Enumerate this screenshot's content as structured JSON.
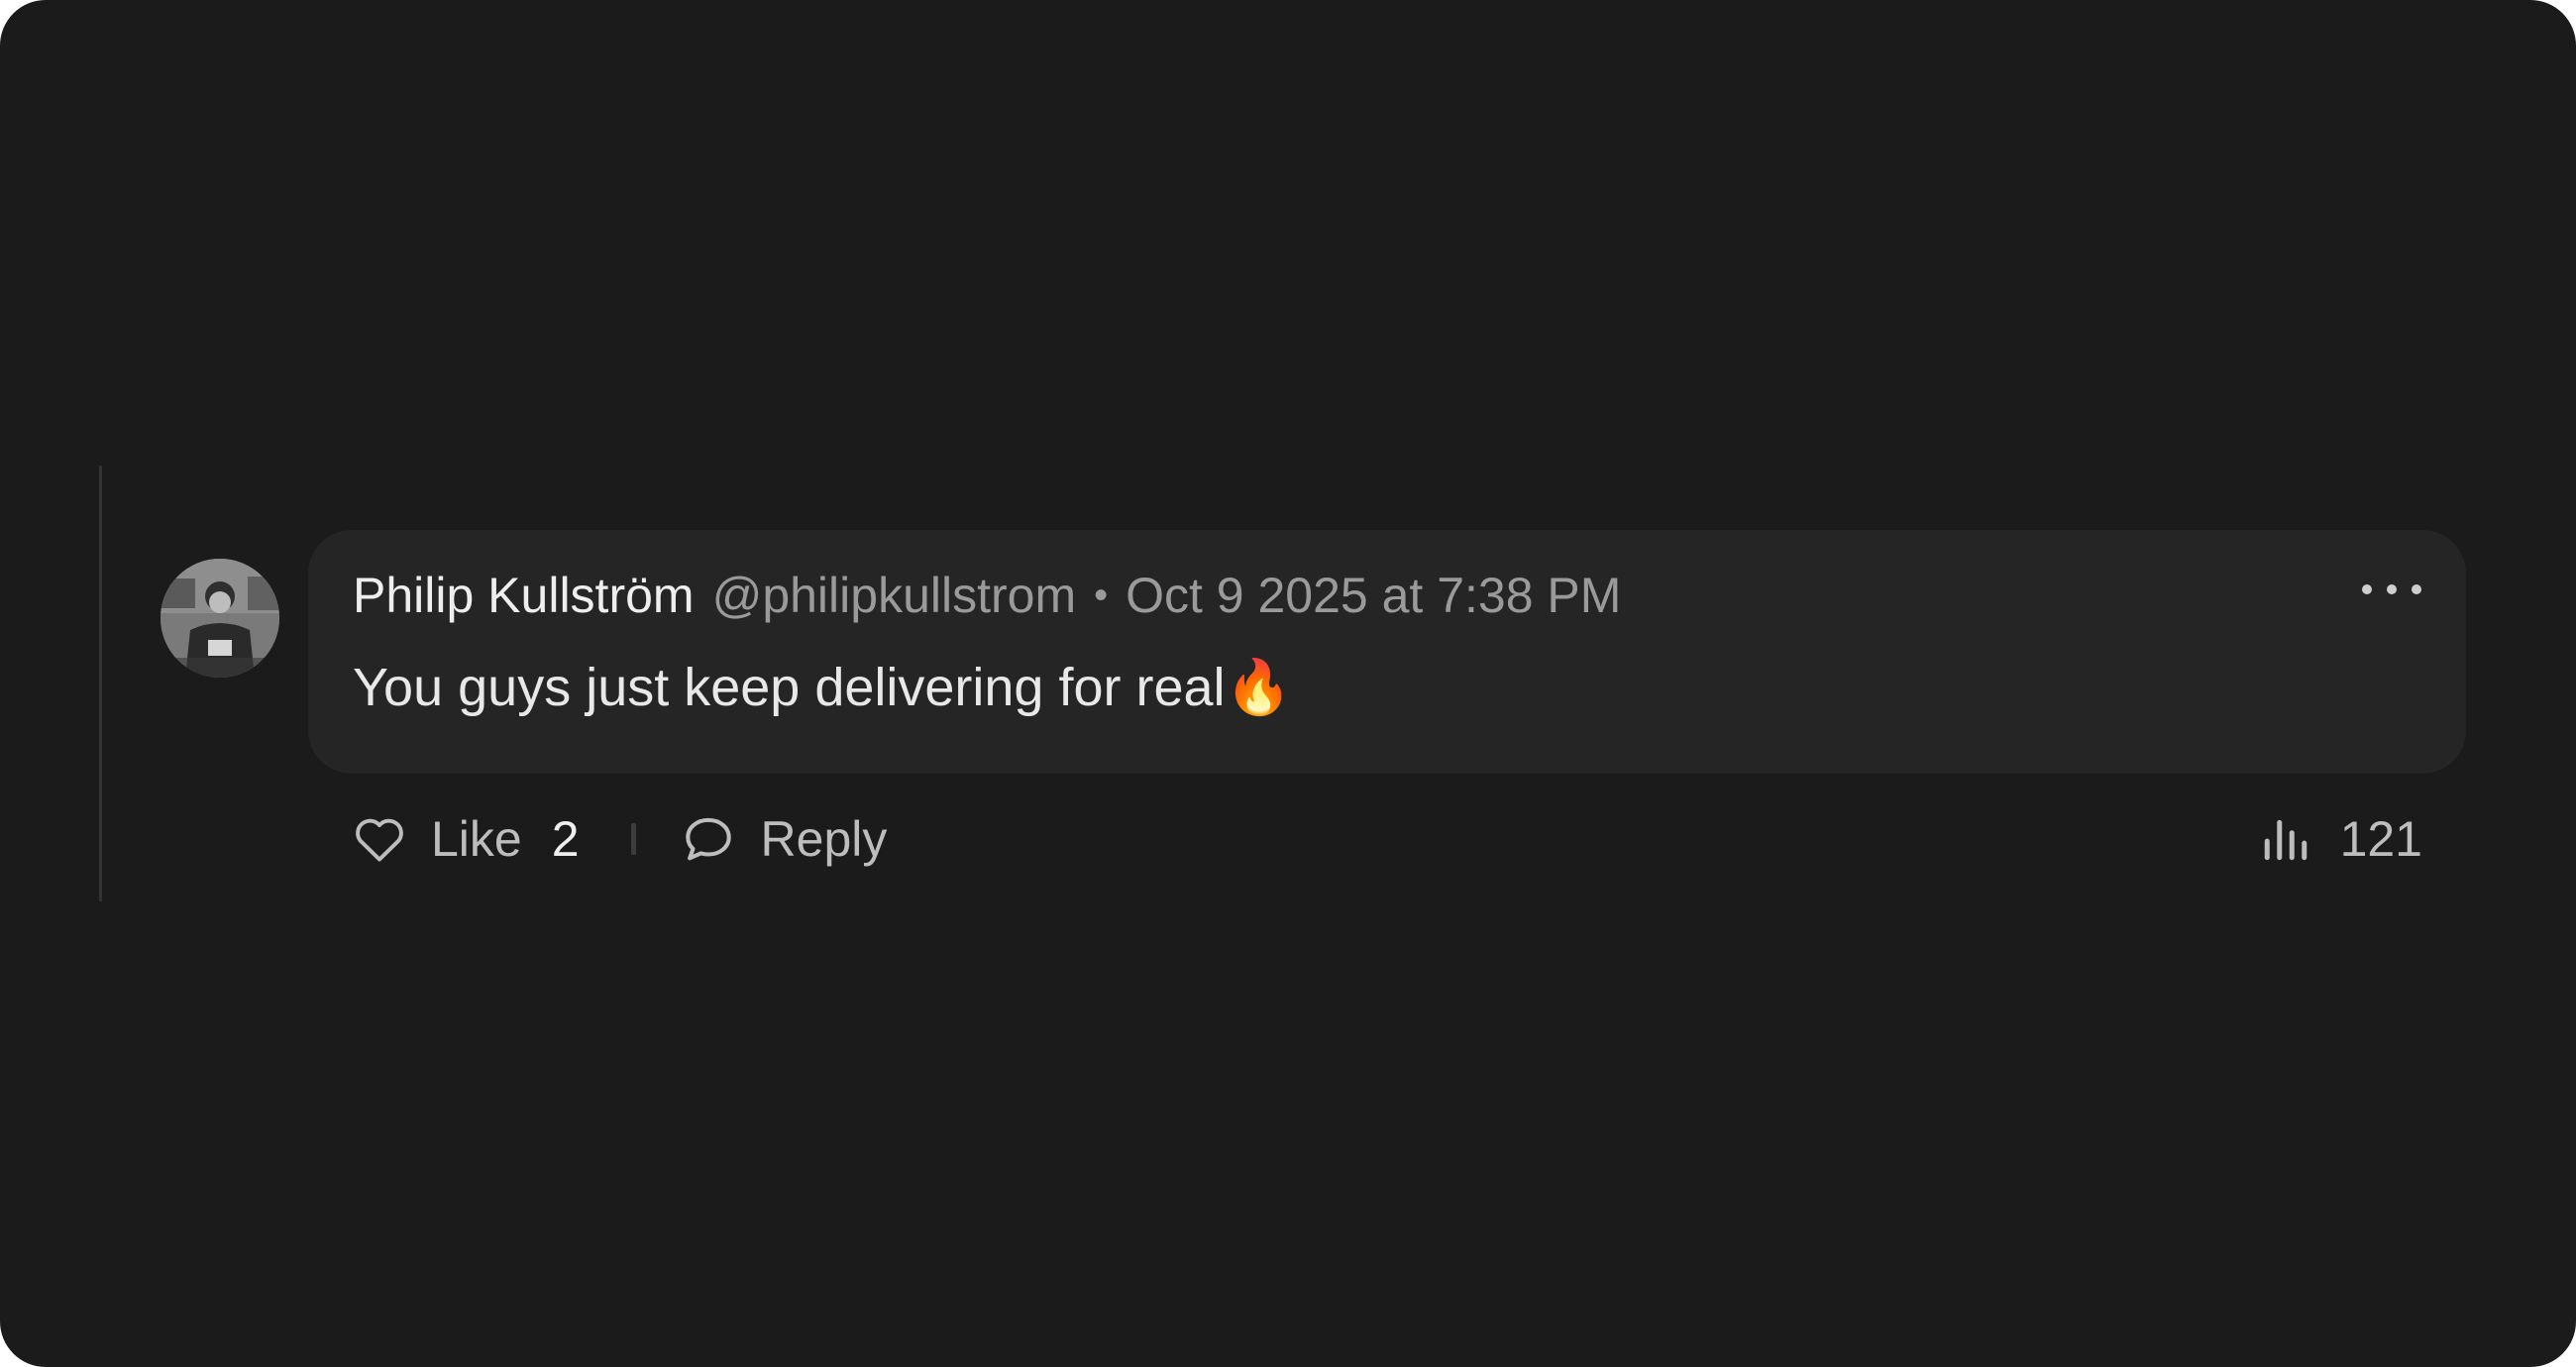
{
  "comment": {
    "author_name": "Philip Kullström",
    "author_handle": "@philipkullstrom",
    "separator": "•",
    "timestamp": "Oct 9 2025 at 7:38 PM",
    "text": "You guys just keep delivering for real🔥",
    "avatar_icon": "user-photo-avatar",
    "more_icon": "more-horizontal-icon"
  },
  "actions": {
    "like_icon": "heart-outline-icon",
    "like_label": "Like",
    "like_count": "2",
    "reply_icon": "speech-bubble-icon",
    "reply_label": "Reply",
    "views_icon": "bar-chart-icon",
    "views_count": "121"
  },
  "colors": {
    "background": "#1b1b1b",
    "bubble": "#252525",
    "text_primary": "#eeeeee",
    "text_secondary": "#9a9a9a"
  }
}
